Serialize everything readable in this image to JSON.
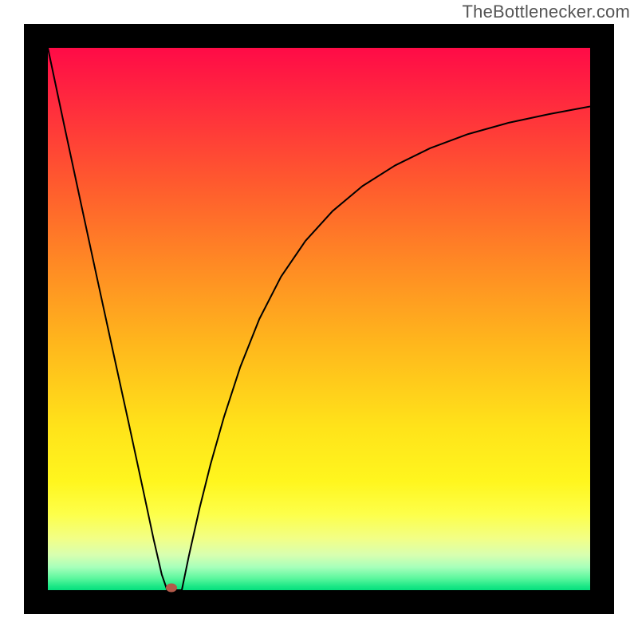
{
  "watermark": {
    "text": "TheBottlenecker.com"
  },
  "frame": {
    "border_color": "#000000",
    "border_px": 30
  },
  "gradient": {
    "stops": [
      {
        "offset": 0.0,
        "color": "#ff0b47"
      },
      {
        "offset": 0.1,
        "color": "#ff2a3e"
      },
      {
        "offset": 0.25,
        "color": "#ff5a2e"
      },
      {
        "offset": 0.4,
        "color": "#ff8a24"
      },
      {
        "offset": 0.55,
        "color": "#ffb81c"
      },
      {
        "offset": 0.7,
        "color": "#ffe31a"
      },
      {
        "offset": 0.8,
        "color": "#fff61e"
      },
      {
        "offset": 0.86,
        "color": "#fdff4a"
      },
      {
        "offset": 0.905,
        "color": "#f2ff87"
      },
      {
        "offset": 0.935,
        "color": "#d8ffb0"
      },
      {
        "offset": 0.958,
        "color": "#a6ffba"
      },
      {
        "offset": 0.978,
        "color": "#5cf79e"
      },
      {
        "offset": 0.992,
        "color": "#1fe887"
      },
      {
        "offset": 1.0,
        "color": "#05df7e"
      }
    ]
  },
  "marker": {
    "x_frac": 0.228,
    "y_frac": 0.995,
    "color": "#b35a4a"
  },
  "chart_data": {
    "type": "line",
    "title": "",
    "xlabel": "",
    "ylabel": "",
    "xlim": [
      0,
      1
    ],
    "ylim": [
      0,
      1
    ],
    "legend": false,
    "grid": false,
    "series": [
      {
        "name": "left-branch",
        "stroke": "#000000",
        "x": [
          0.0,
          0.03,
          0.06,
          0.09,
          0.12,
          0.15,
          0.175,
          0.195,
          0.21,
          0.22
        ],
        "values": [
          1.0,
          0.858,
          0.718,
          0.579,
          0.441,
          0.304,
          0.188,
          0.094,
          0.029,
          0.0
        ]
      },
      {
        "name": "valley-floor",
        "stroke": "#000000",
        "x": [
          0.22,
          0.247
        ],
        "values": [
          0.0,
          0.0
        ]
      },
      {
        "name": "right-branch",
        "stroke": "#000000",
        "x": [
          0.247,
          0.26,
          0.28,
          0.3,
          0.325,
          0.355,
          0.39,
          0.43,
          0.475,
          0.525,
          0.58,
          0.64,
          0.705,
          0.775,
          0.85,
          0.925,
          1.0
        ],
        "values": [
          0.0,
          0.063,
          0.152,
          0.232,
          0.32,
          0.412,
          0.5,
          0.578,
          0.644,
          0.699,
          0.745,
          0.783,
          0.815,
          0.841,
          0.862,
          0.878,
          0.892
        ]
      }
    ],
    "annotations": [
      {
        "type": "marker",
        "x": 0.228,
        "y": 0.005,
        "shape": "ellipse",
        "color": "#b35a4a"
      }
    ]
  }
}
